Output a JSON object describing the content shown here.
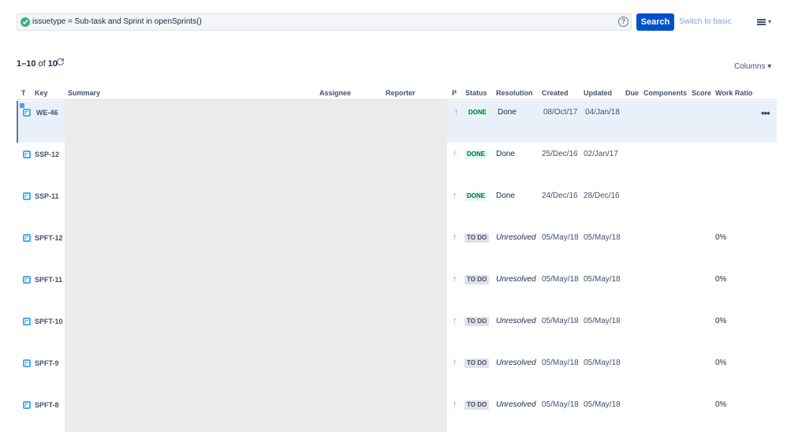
{
  "search": {
    "query": "issuetype = Sub-task and Sprint in openSprints()",
    "help_glyph": "?",
    "button_label": "Search",
    "switch_label": "Switch to basic"
  },
  "results": {
    "range": "1–10",
    "of_label": "of",
    "total": "10",
    "columns_label": "Columns"
  },
  "columns": {
    "t": "T",
    "key": "Key",
    "summary": "Summary",
    "assignee": "Assignee",
    "reporter": "Reporter",
    "p": "P",
    "status": "Status",
    "resolution": "Resolution",
    "created": "Created",
    "updated": "Updated",
    "due": "Due",
    "components": "Components",
    "score": "Score",
    "work_ratio": "Work Ratio"
  },
  "icons": {
    "type": "subtask-icon",
    "priority": "arrow-up-icon",
    "priority_color": "#ff7b24",
    "done_color": "#006644",
    "brand_color": "#0052cc"
  },
  "rows": [
    {
      "key": "WE-46",
      "status": "DONE",
      "resolution": "Done",
      "created": "08/Oct/17",
      "updated": "04/Jan/18",
      "ratio": ""
    },
    {
      "key": "SSP-12",
      "status": "DONE",
      "resolution": "Done",
      "created": "25/Dec/16",
      "updated": "02/Jan/17",
      "ratio": ""
    },
    {
      "key": "SSP-11",
      "status": "DONE",
      "resolution": "Done",
      "created": "24/Dec/16",
      "updated": "28/Dec/16",
      "ratio": ""
    },
    {
      "key": "SPFT-12",
      "status": "TO DO",
      "resolution": "Unresolved",
      "created": "05/May/18",
      "updated": "05/May/18",
      "ratio": "0%"
    },
    {
      "key": "SPFT-11",
      "status": "TO DO",
      "resolution": "Unresolved",
      "created": "05/May/18",
      "updated": "05/May/18",
      "ratio": "0%"
    },
    {
      "key": "SPFT-10",
      "status": "TO DO",
      "resolution": "Unresolved",
      "created": "05/May/18",
      "updated": "05/May/18",
      "ratio": "0%"
    },
    {
      "key": "SPFT-9",
      "status": "TO DO",
      "resolution": "Unresolved",
      "created": "05/May/18",
      "updated": "05/May/18",
      "ratio": "0%"
    },
    {
      "key": "SPFT-8",
      "status": "TO DO",
      "resolution": "Unresolved",
      "created": "05/May/18",
      "updated": "05/May/18",
      "ratio": "0%"
    }
  ]
}
